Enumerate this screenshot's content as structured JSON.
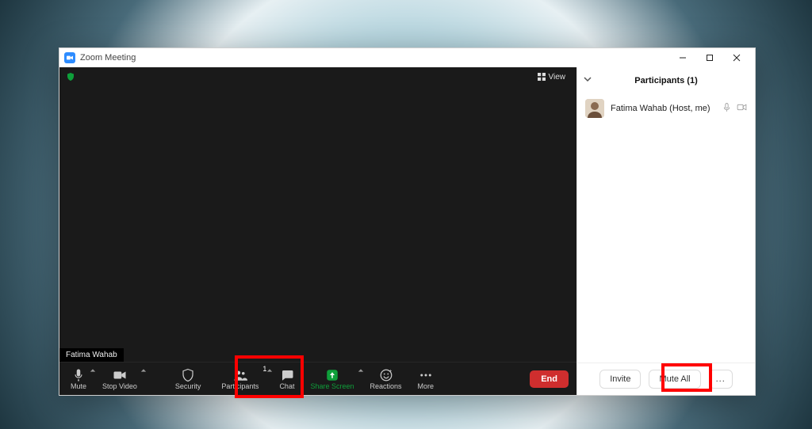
{
  "window": {
    "title": "Zoom Meeting"
  },
  "meeting": {
    "view_label": "View",
    "presenter_name": "Fatima Wahab"
  },
  "toolbar": {
    "mute": "Mute",
    "stop_video": "Stop Video",
    "security": "Security",
    "participants": "Participants",
    "participants_count": "1",
    "chat": "Chat",
    "share_screen": "Share Screen",
    "reactions": "Reactions",
    "more": "More",
    "end": "End"
  },
  "participants_panel": {
    "title": "Participants (1)",
    "rows": [
      {
        "name": "Fatima Wahab (Host, me)"
      }
    ],
    "invite": "Invite",
    "mute_all": "Mute All",
    "more": "..."
  }
}
